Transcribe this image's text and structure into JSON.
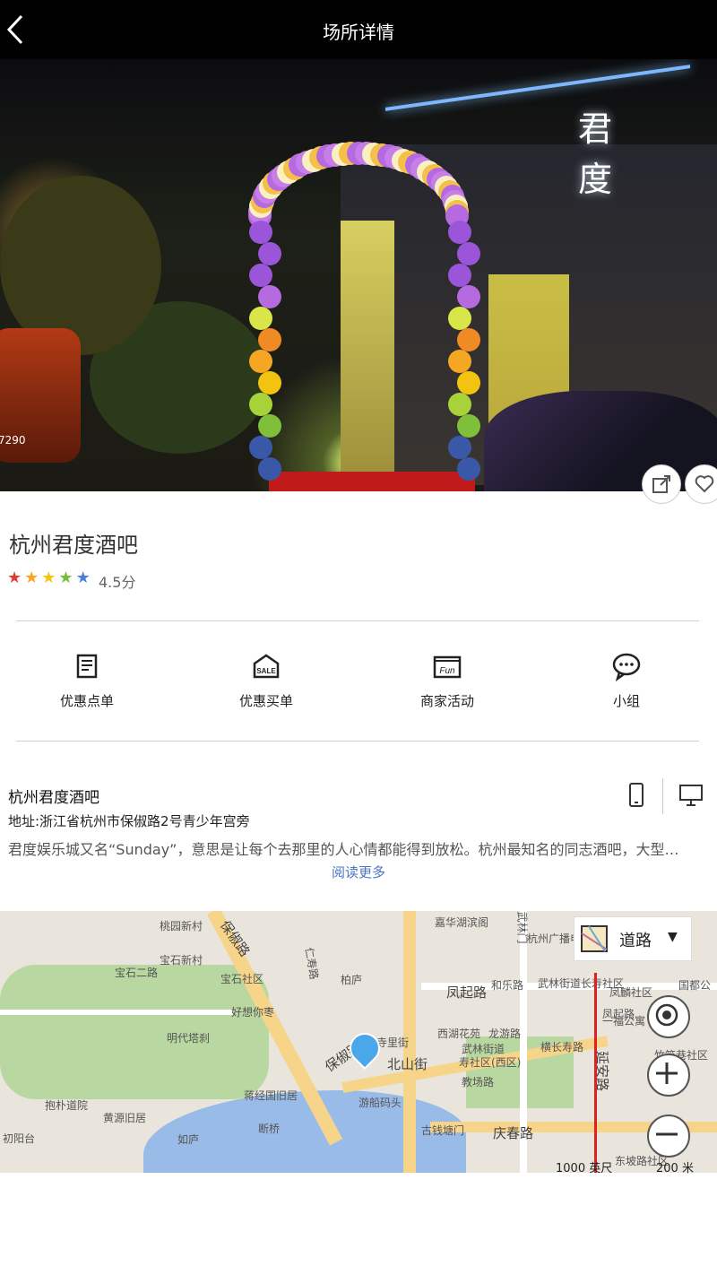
{
  "header": {
    "title": "场所详情"
  },
  "venue": {
    "name": "杭州君度酒吧",
    "rating_stars": "★★★★★",
    "rating_text": "4.5分",
    "rating_value": 4.5,
    "star_colors": [
      "#e53935",
      "#f5a623",
      "#f2c40f",
      "#6fbf3a",
      "#4a7fd4"
    ]
  },
  "hero": {
    "sign_text": "君度",
    "plate_text": "7290"
  },
  "actions": [
    {
      "label": "优惠点单",
      "icon": "menu-doc-icon"
    },
    {
      "label": "优惠买单",
      "icon": "sale-tag-icon"
    },
    {
      "label": "商家活动",
      "icon": "fun-calendar-icon"
    },
    {
      "label": "小组",
      "icon": "chat-group-icon"
    }
  ],
  "info": {
    "name": "杭州君度酒吧",
    "address": "地址:浙江省杭州市保俶路2号青少年宫旁",
    "description": "君度娱乐城又名“Sunday”，意思是让每个去那里的人心情都能得到放松。杭州最知名的同志酒吧，大型…",
    "read_more": "阅读更多"
  },
  "map": {
    "layer_label": "道路",
    "scale_left": "1000 英尺",
    "scale_right": "200 米",
    "labels": [
      "桃园新村",
      "宝石新村",
      "宝石二路",
      "宝石社区",
      "保俶路",
      "好想你枣",
      "明代塔刹",
      "抱朴道院",
      "黄源旧居",
      "初阳台",
      "断桥",
      "如庐",
      "蒋经国旧居",
      "北山街",
      "游船码头",
      "保俶路",
      "西湖花苑",
      "龙游路",
      "武林街道",
      "寿社区(西区)",
      "教场路",
      "横长寿路",
      "庆春路",
      "凤起路",
      "和乐路",
      "武林街道长寿社区",
      "杭州广播电视大学",
      "凤起路",
      "延安路",
      "寺里街",
      "柏庐",
      "仁寿路",
      "嘉华湖滨阁",
      "古钱塘门",
      "东坡路社区",
      "武林门",
      "国都公",
      "竹竿巷社区",
      "一福公寓",
      "凤麟社区"
    ]
  }
}
